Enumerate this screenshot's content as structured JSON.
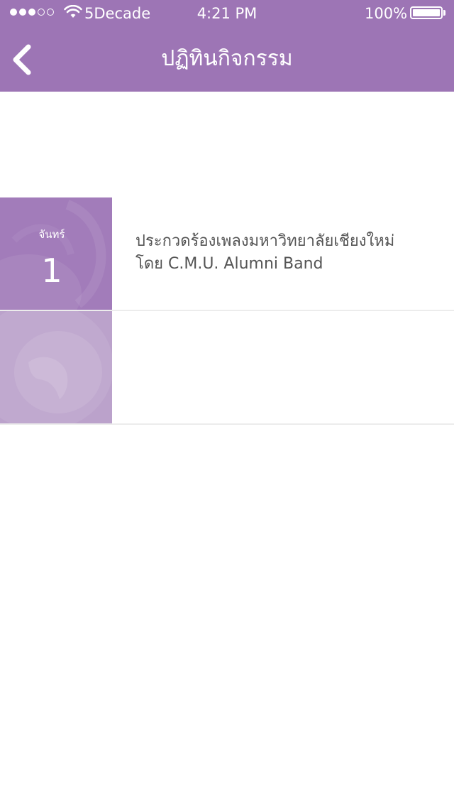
{
  "status_bar": {
    "signal_full": 3,
    "signal_total": 5,
    "carrier": "5Decade",
    "time": "4:21 PM",
    "battery": "100%"
  },
  "nav": {
    "back_icon": "chevron-left-icon",
    "title": "ปฏิทินกิจกรรม"
  },
  "events": [
    {
      "day_name": "จันทร์",
      "day_number": "1",
      "title_line1": "ประกวดร้องเพลงมหาวิทยาลัยเชียงใหม่",
      "title_line2": "โดย C.M.U. Alumni Band"
    }
  ],
  "colors": {
    "brand_purple": "#9d75b5",
    "tile_purple": "#a27cba",
    "tile_light": "#bba2cb",
    "text_gray": "#555555"
  }
}
